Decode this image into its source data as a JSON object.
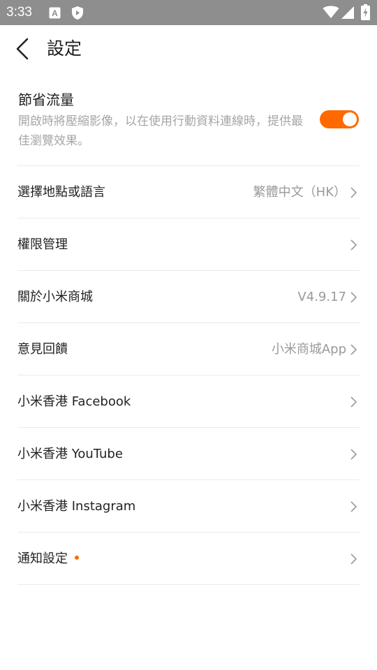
{
  "status_bar": {
    "time": "3:33",
    "icons": [
      "a-icon",
      "shield-play-icon",
      "wifi-icon",
      "cellular-icon",
      "battery-charging-icon"
    ]
  },
  "header": {
    "title": "設定",
    "back_icon": "back-arrow-icon"
  },
  "data_saver": {
    "title": "節省流量",
    "description": "開啟時將壓縮影像，以在使用行動資料連線時，提供最佳瀏覽效果。",
    "enabled": true,
    "accent_color": "#ff6900"
  },
  "settings": [
    {
      "label": "選擇地點或語言",
      "value": "繁體中文（HK）"
    },
    {
      "label": "權限管理",
      "value": ""
    },
    {
      "label": "關於小米商城",
      "value": "V4.9.17"
    },
    {
      "label": "意見回饋",
      "value": "小米商城App"
    },
    {
      "label": "小米香港 Facebook",
      "value": ""
    },
    {
      "label": "小米香港 YouTube",
      "value": ""
    },
    {
      "label": "小米香港 Instagram",
      "value": ""
    },
    {
      "label": "通知設定",
      "value": "",
      "badge_dot": true
    }
  ]
}
